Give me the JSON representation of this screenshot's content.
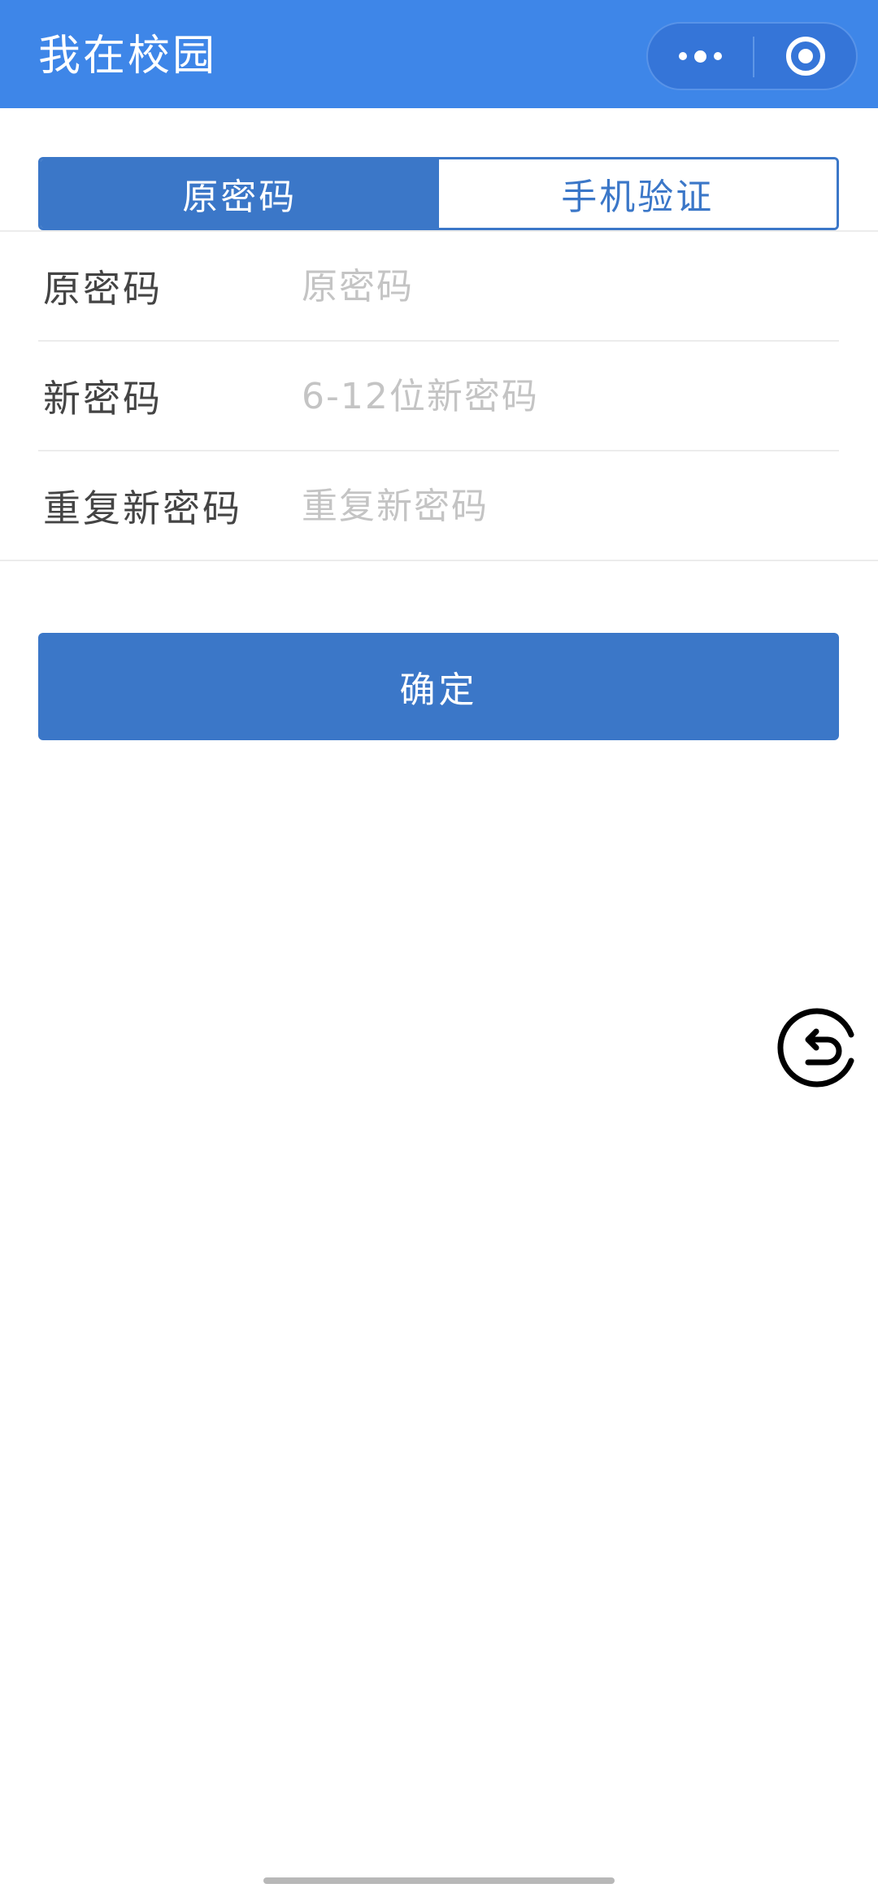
{
  "header": {
    "title": "我在校园",
    "more_icon": "more-dots-icon",
    "close_icon": "target-close-icon",
    "bg_color": "#3e86e8"
  },
  "tabs": [
    {
      "label": "原密码",
      "active": true
    },
    {
      "label": "手机验证",
      "active": false
    }
  ],
  "form": {
    "rows": [
      {
        "label": "原密码",
        "placeholder": "原密码",
        "value": ""
      },
      {
        "label": "新密码",
        "placeholder": "6-12位新密码",
        "value": ""
      },
      {
        "label": "重复新密码",
        "placeholder": "重复新密码",
        "value": ""
      }
    ]
  },
  "confirm_label": "确定",
  "float_button": {
    "icon": "undo-return-icon"
  },
  "colors": {
    "accent": "#3b77c8",
    "placeholder": "#c4c4c4",
    "label": "#444444"
  }
}
